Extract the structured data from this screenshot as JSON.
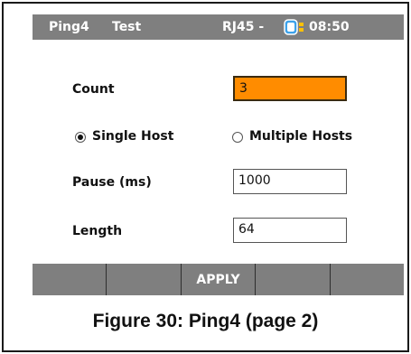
{
  "header": {
    "mode": "Ping4",
    "screen": "Test",
    "interface": "RJ45 -",
    "battery_icon": "battery-icon",
    "time": "08:50",
    "colors": {
      "bar": "#7f7f7f",
      "battery": "#3da2ea",
      "battery_level": "#ffc107"
    }
  },
  "form": {
    "count_label": "Count",
    "count_value": "3",
    "single_host_label": "Single Host",
    "multiple_hosts_label": "Multiple Hosts",
    "selected_host_mode": "Single Host",
    "pause_label": "Pause (ms)",
    "pause_value": "1000",
    "length_label": "Length",
    "length_value": "64",
    "active_field_color": "#ff8c00"
  },
  "softkeys": [
    "",
    "",
    "APPLY",
    "",
    ""
  ],
  "caption": "Figure 30: Ping4 (page 2)"
}
